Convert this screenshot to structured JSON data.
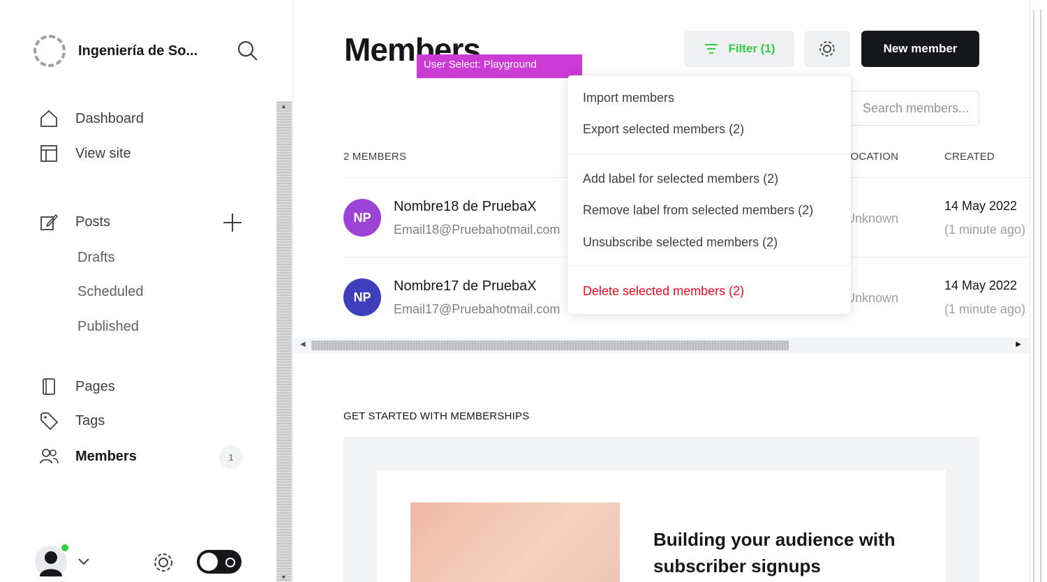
{
  "site": {
    "title": "Ingeniería de So..."
  },
  "nav": {
    "dashboard": "Dashboard",
    "view_site": "View site",
    "posts": "Posts",
    "drafts": "Drafts",
    "scheduled": "Scheduled",
    "published": "Published",
    "pages": "Pages",
    "tags": "Tags",
    "members": "Members",
    "members_count": "1"
  },
  "header": {
    "title": "Members",
    "playground_tag": "User Select: Playground",
    "filter_label": "Filter (1)",
    "new_member_label": "New member",
    "search_placeholder": "Search members..."
  },
  "table": {
    "count_label": "2 MEMBERS",
    "columns": {
      "location": "LOCATION",
      "created": "CREATED"
    },
    "rows": [
      {
        "initials": "NP",
        "name": "Nombre18 de PruebaX",
        "email": "Email18@Pruebahotmail.com",
        "location": "Unknown",
        "date": "14 May 2022",
        "ago": "(1 minute ago)",
        "avatar_color": "#9c44d6"
      },
      {
        "initials": "NP",
        "name": "Nombre17 de PruebaX",
        "email": "Email17@Pruebahotmail.com",
        "location": "Unknown",
        "date": "14 May 2022",
        "ago": "(1 minute ago)",
        "avatar_color": "#3f3fbd"
      }
    ]
  },
  "dropdown": {
    "import": "Import members",
    "export": "Export selected members (2)",
    "add_label": "Add label for selected members (2)",
    "remove_label": "Remove label from selected members (2)",
    "unsubscribe": "Unsubscribe selected members (2)",
    "delete": "Delete selected members (2)"
  },
  "getting_started": {
    "heading": "GET STARTED WITH MEMBERSHIPS",
    "card_title": "Building your audience with subscriber signups"
  },
  "colors": {
    "accent_green": "#30cf43",
    "danger": "#f50b23",
    "dark": "#15171a",
    "playground_tag": "#cc3bd6"
  },
  "icons": [
    "search-icon",
    "home-icon",
    "view-site-icon",
    "edit-icon",
    "plus-icon",
    "page-icon",
    "tag-icon",
    "members-icon",
    "filter-icon",
    "gear-icon",
    "chevron-down-icon",
    "moon-icon"
  ]
}
